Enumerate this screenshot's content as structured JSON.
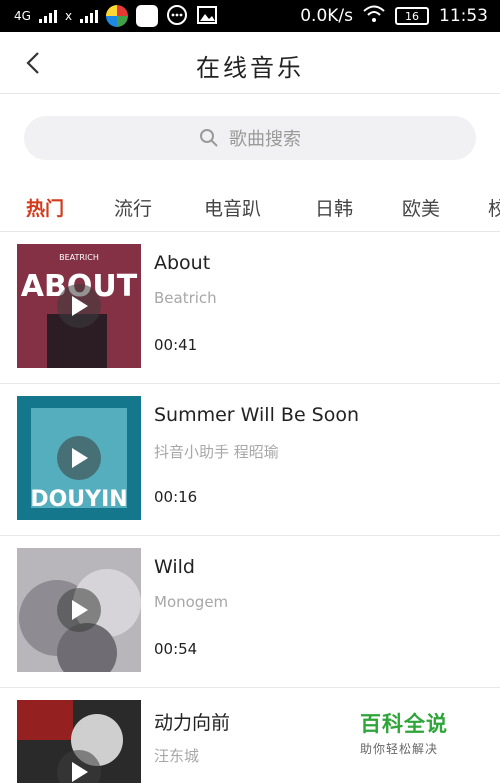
{
  "status_bar": {
    "network1": "4G",
    "network2": "x",
    "speed": "0.0K/s",
    "battery": "16",
    "time": "11:53"
  },
  "header": {
    "title": "在线音乐"
  },
  "search": {
    "placeholder": "歌曲搜索"
  },
  "tabs": [
    {
      "label": "热门"
    },
    {
      "label": "流行"
    },
    {
      "label": "电音趴"
    },
    {
      "label": "日韩"
    },
    {
      "label": "欧美"
    },
    {
      "label": "校"
    }
  ],
  "songs": [
    {
      "title": "About",
      "artist": "Beatrich",
      "duration": "00:41",
      "cover_text": "ABOUT",
      "cover_small": "BEATRICH"
    },
    {
      "title": "Summer Will Be Soon",
      "artist": "抖音小助手 程昭瑜",
      "duration": "00:16",
      "cover_text": "DOUYIN"
    },
    {
      "title": "Wild",
      "artist": "Monogem",
      "duration": "00:54"
    },
    {
      "title": "动力向前",
      "artist": "汪东城",
      "duration": ""
    }
  ],
  "watermark": {
    "title": "百科全说",
    "subtitle": "助你轻松解决"
  },
  "colors": {
    "accent": "#d23a1a",
    "watermark": "#2fa53a"
  }
}
